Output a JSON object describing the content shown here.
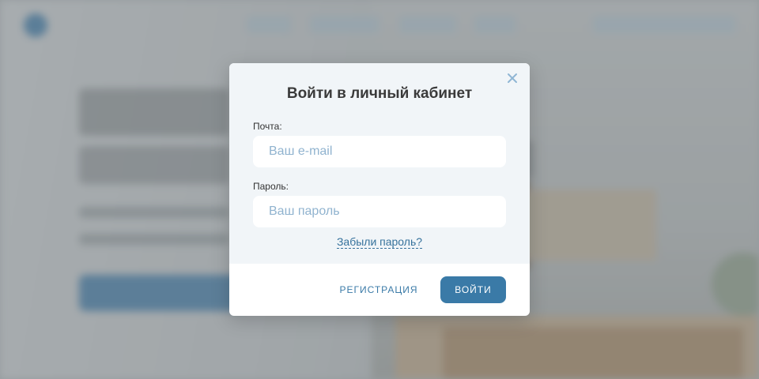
{
  "login_modal": {
    "title": "Войти в личный кабинет",
    "close_icon": "close-icon",
    "email": {
      "label": "Почта:",
      "placeholder": "Ваш e-mail",
      "value": ""
    },
    "password": {
      "label": "Пароль:",
      "placeholder": "Ваш пароль",
      "value": ""
    },
    "forgot_password": "Забыли пароль?",
    "register_button": "РЕГИСТРАЦИЯ",
    "login_button": "ВОЙТИ"
  },
  "colors": {
    "accent": "#3a7aa7",
    "modal_body": "#f1f5f8",
    "placeholder": "#90b3cf"
  }
}
